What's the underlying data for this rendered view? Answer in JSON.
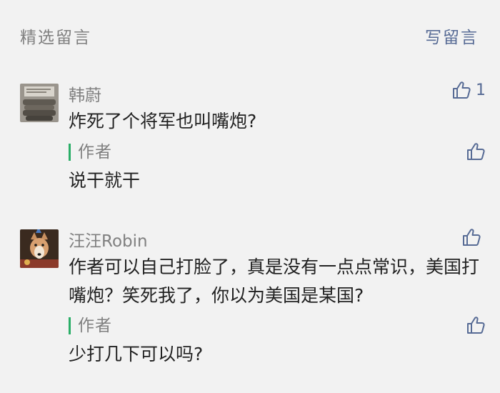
{
  "header": {
    "title": "精选留言",
    "write_label": "写留言"
  },
  "comments": [
    {
      "nickname": "韩蔚",
      "avatar_icon": "stacked-items-photo-avatar",
      "content": "炸死了个将军也叫嘴炮?",
      "likes": "1",
      "reply": {
        "label": "作者",
        "content": "说干就干"
      }
    },
    {
      "nickname": "汪汪Robin",
      "avatar_icon": "dog-photo-avatar",
      "content": "作者可以自己打脸了，真是没有一点点常识，美国打嘴炮？笑死我了，你以为美国是某国?",
      "likes": "",
      "reply": {
        "label": "作者",
        "content": "少打几下可以吗?"
      }
    }
  ],
  "colors": {
    "background": "#f2f2f2",
    "link": "#576b95",
    "author_bar": "#2aae67",
    "muted": "#808080",
    "text": "#222222"
  }
}
